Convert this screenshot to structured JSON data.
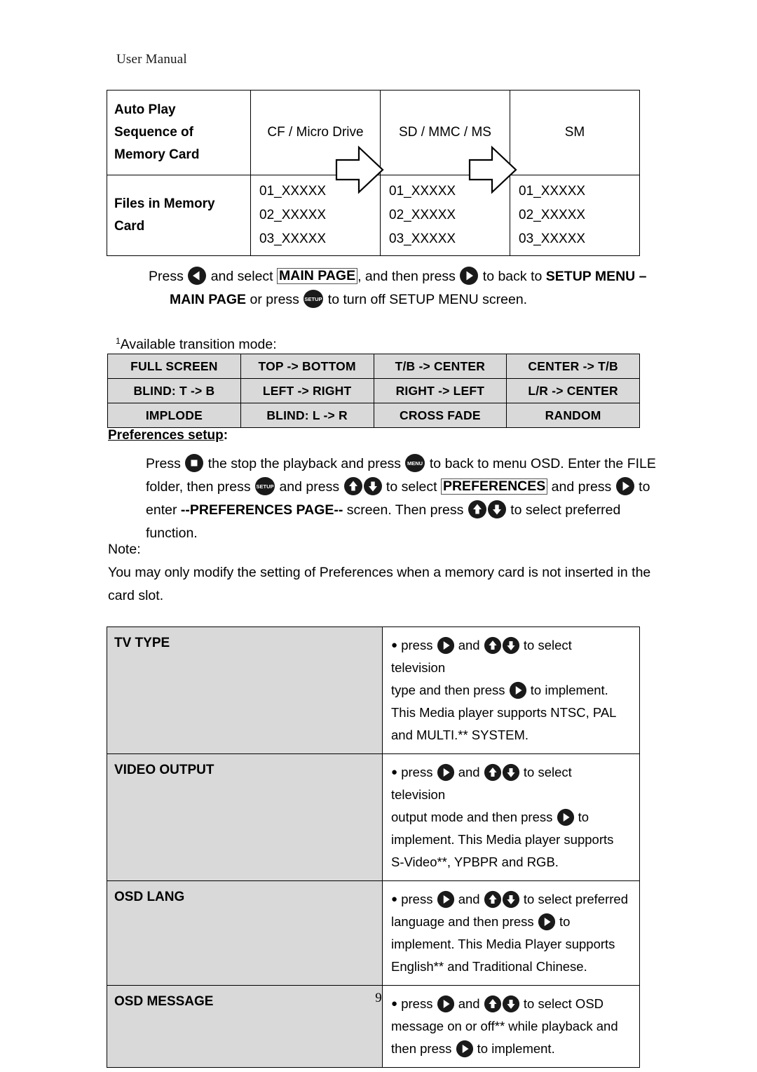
{
  "document": {
    "header": "User Manual",
    "page_number": "9"
  },
  "autoplay_table": {
    "row_labels": [
      "Auto Play Sequence of Memory Card",
      "Files in Memory Card"
    ],
    "label_lines": [
      [
        "Auto Play",
        "Sequence of",
        "Memory Card"
      ],
      [
        "Files in Memory",
        "Card"
      ]
    ],
    "card_types": [
      "CF / Micro Drive",
      "SD / MMC / MS",
      "SM"
    ],
    "file_lists": [
      [
        "01_XXXXX",
        "02_XXXXX",
        "03_XXXXX"
      ],
      [
        "01_XXXXX",
        "02_XXXXX",
        "03_XXXXX"
      ],
      [
        "01_XXXXX",
        "02_XXXXX",
        "03_XXXXX"
      ]
    ],
    "arrow_count": 2
  },
  "main_page_paragraph": {
    "t1": "Press",
    "t2": "and select",
    "boxed1": "MAIN PAGE",
    "t3": ", and then press",
    "t4": "to back to",
    "bold1": "SETUP MENU –",
    "bold2": "MAIN PAGE",
    "t5": "or press",
    "t6": "to turn off SETUP MENU screen."
  },
  "transition_note": {
    "superscript": "1",
    "text": "Available transition mode:"
  },
  "transition_table": {
    "rows": [
      [
        "FULL SCREEN",
        "TOP -> BOTTOM",
        "T/B -> CENTER",
        "CENTER -> T/B"
      ],
      [
        "BLIND: T -> B",
        "LEFT -> RIGHT",
        "RIGHT -> LEFT",
        "L/R -> CENTER"
      ],
      [
        "IMPLODE",
        "BLIND: L -> R",
        "CROSS FADE",
        "RANDOM"
      ]
    ]
  },
  "preferences_heading": {
    "underlined": "Preferences setup",
    "colon": ":"
  },
  "preferences_paragraph": {
    "t1": "Press",
    "t2": "the stop the playback and press",
    "t3": "to back to menu OSD. Enter the FILE",
    "t4": "folder, then press",
    "t5": "and press",
    "t6": "to select",
    "boxed1": "PREFERENCES",
    "t7": "and press",
    "t8": "to",
    "t9": "enter",
    "bold1": "--PREFERENCES PAGE--",
    "t10": "screen. Then press",
    "t11": "to select preferred function."
  },
  "note": {
    "label": "Note:",
    "body": "You may only modify the setting of Preferences when a memory card is not inserted in the card slot."
  },
  "preferences_table": {
    "rows": [
      {
        "name": "TV TYPE",
        "lines": [
          {
            "pre": "press",
            "mid": "and",
            "post": "to select television",
            "icons": [
              "right",
              "updown"
            ]
          },
          {
            "pre": "type and then press",
            "post": "to implement.",
            "icons": [
              "right"
            ]
          },
          {
            "pre": "This Media player supports NTSC, PAL",
            "icons": []
          },
          {
            "pre": "and MULTI.** SYSTEM.",
            "icons": []
          }
        ]
      },
      {
        "name": "VIDEO OUTPUT",
        "lines": [
          {
            "pre": "press",
            "mid": "and",
            "post": "to select television",
            "icons": [
              "right",
              "updown"
            ]
          },
          {
            "pre": "output mode and then press",
            "post": "to",
            "icons": [
              "right"
            ]
          },
          {
            "pre": "implement. This Media player supports",
            "icons": []
          },
          {
            "pre": "S-Video**, YPBPR and RGB.",
            "icons": []
          }
        ]
      },
      {
        "name": "OSD LANG",
        "lines": [
          {
            "pre": "press",
            "mid": "and",
            "post": "to select preferred",
            "icons": [
              "right",
              "updown"
            ]
          },
          {
            "pre": "language and then press",
            "post": "to",
            "icons": [
              "right"
            ]
          },
          {
            "pre": "implement. This Media Player supports",
            "icons": []
          },
          {
            "pre": "English** and Traditional Chinese.",
            "icons": []
          }
        ]
      },
      {
        "name": "OSD MESSAGE",
        "lines": [
          {
            "pre": "press",
            "mid": "and",
            "post": "to select OSD",
            "icons": [
              "right",
              "updown"
            ]
          },
          {
            "pre": "message on or off** while playback and",
            "icons": []
          },
          {
            "pre": "then press",
            "post": "to implement.",
            "icons": [
              "right"
            ]
          }
        ]
      }
    ]
  },
  "icons": {
    "left_arrow": "left-arrow-button-icon",
    "right_arrow": "right-arrow-button-icon",
    "up_arrow": "up-arrow-button-icon",
    "down_arrow": "down-arrow-button-icon",
    "setup": "setup-button-icon",
    "menu": "menu-button-icon",
    "stop": "stop-button-icon",
    "setup_label": "SETUP",
    "menu_label": "MENU"
  },
  "colors": {
    "table_shade": "#d9d9d9",
    "border": "#000000",
    "text": "#111111"
  }
}
